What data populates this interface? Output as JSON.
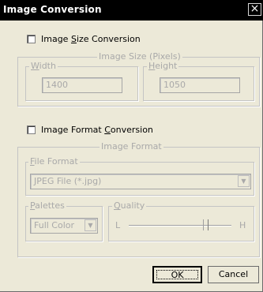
{
  "window": {
    "title": "Image Conversion",
    "close_glyph": "×"
  },
  "size": {
    "checkbox_label_pre": "Image ",
    "checkbox_label_mn": "S",
    "checkbox_label_post": "ize Conversion",
    "checked": false,
    "group_label": "Image Size (Pixels)",
    "width_label": "Width",
    "width_mn": "W",
    "width_rest": "idth",
    "width_value": "1400",
    "height_label": "Height",
    "height_mn": "H",
    "height_rest": "eight",
    "height_value": "1050"
  },
  "format": {
    "checkbox_label_pre": "Image Format ",
    "checkbox_label_mn": "C",
    "checkbox_label_post": "onversion",
    "checked": false,
    "group_label": "Image Format",
    "file_format_mn": "F",
    "file_format_rest": "ile Format",
    "file_format_value": "JPEG File (*.jpg)",
    "palettes_mn": "P",
    "palettes_rest": "alettes",
    "palettes_value": "Full Color",
    "quality_mn": "Q",
    "quality_rest": "uality",
    "quality_low": "L",
    "quality_high": "H",
    "quality_level": 0.75
  },
  "buttons": {
    "ok": "OK",
    "cancel": "Cancel"
  },
  "icons": {
    "dropdown": "chevron-down-icon",
    "close": "close-icon"
  }
}
